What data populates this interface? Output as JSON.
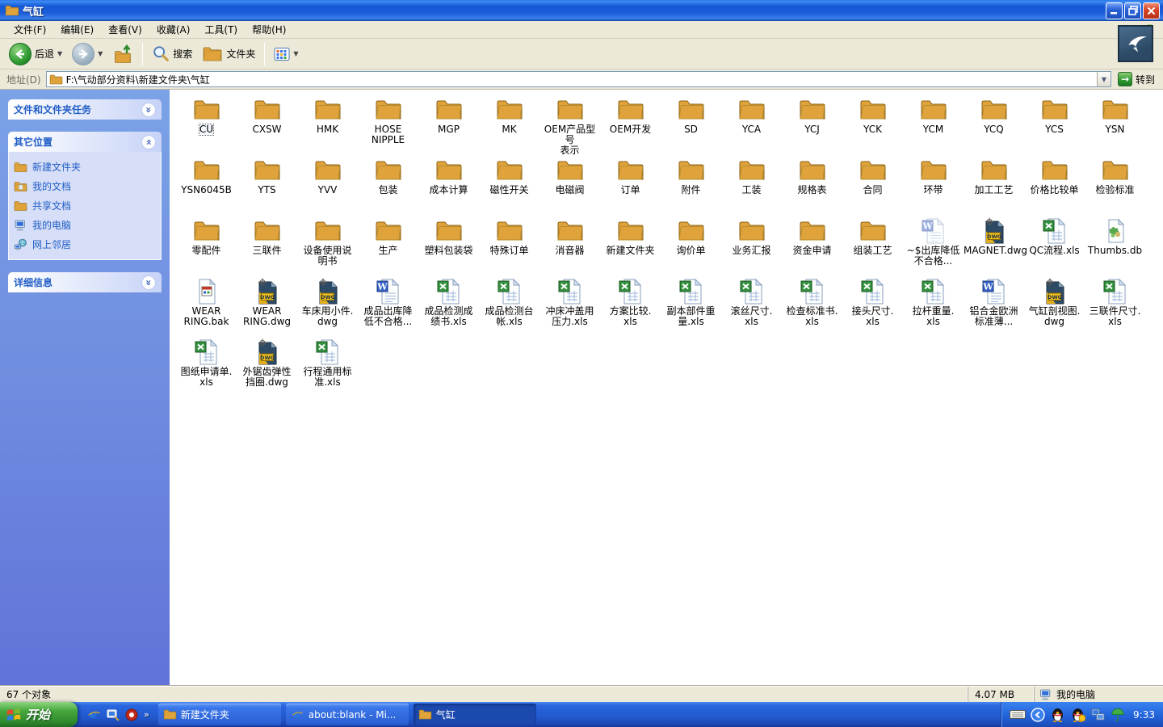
{
  "window": {
    "title": "气缸"
  },
  "menu": {
    "items": [
      "文件(F)",
      "编辑(E)",
      "查看(V)",
      "收藏(A)",
      "工具(T)",
      "帮助(H)"
    ]
  },
  "toolbar": {
    "back_label": "后退",
    "search_label": "搜索",
    "folders_label": "文件夹"
  },
  "address": {
    "label": "地址(D)",
    "value": "F:\\气动部分资料\\新建文件夹\\气缸",
    "go_label": "转到"
  },
  "sidebar": {
    "tasks_title": "文件和文件夹任务",
    "places_title": "其它位置",
    "details_title": "详细信息",
    "places": [
      {
        "label": "新建文件夹",
        "icon": "folder"
      },
      {
        "label": "我的文档",
        "icon": "mydocs"
      },
      {
        "label": "共享文档",
        "icon": "folder"
      },
      {
        "label": "我的电脑",
        "icon": "computer"
      },
      {
        "label": "网上邻居",
        "icon": "network"
      }
    ]
  },
  "main": {
    "items": [
      {
        "l": "CU",
        "t": "folder",
        "sel": true
      },
      {
        "l": "CXSW",
        "t": "folder"
      },
      {
        "l": "HMK",
        "t": "folder"
      },
      {
        "l": "HOSE NIPPLE",
        "t": "folder"
      },
      {
        "l": "MGP",
        "t": "folder"
      },
      {
        "l": "MK",
        "t": "folder"
      },
      {
        "l": "OEM产品型号\n表示",
        "t": "folder"
      },
      {
        "l": "OEM开发",
        "t": "folder"
      },
      {
        "l": "SD",
        "t": "folder"
      },
      {
        "l": "YCA",
        "t": "folder"
      },
      {
        "l": "YCJ",
        "t": "folder"
      },
      {
        "l": "YCK",
        "t": "folder"
      },
      {
        "l": "YCM",
        "t": "folder"
      },
      {
        "l": "YCQ",
        "t": "folder"
      },
      {
        "l": "YCS",
        "t": "folder"
      },
      {
        "l": "YSN",
        "t": "folder"
      },
      {
        "l": "YSN6045B",
        "t": "folder"
      },
      {
        "l": "YTS",
        "t": "folder"
      },
      {
        "l": "YVV",
        "t": "folder"
      },
      {
        "l": "包装",
        "t": "folder"
      },
      {
        "l": "成本计算",
        "t": "folder"
      },
      {
        "l": "磁性开关",
        "t": "folder"
      },
      {
        "l": "电磁阀",
        "t": "folder"
      },
      {
        "l": "订单",
        "t": "folder"
      },
      {
        "l": "附件",
        "t": "folder"
      },
      {
        "l": "工装",
        "t": "folder"
      },
      {
        "l": "规格表",
        "t": "folder"
      },
      {
        "l": "合同",
        "t": "folder"
      },
      {
        "l": "环带",
        "t": "folder"
      },
      {
        "l": "加工工艺",
        "t": "folder"
      },
      {
        "l": "价格比较单",
        "t": "folder"
      },
      {
        "l": "检验标准",
        "t": "folder"
      },
      {
        "l": "零配件",
        "t": "folder"
      },
      {
        "l": "三联件",
        "t": "folder"
      },
      {
        "l": "设备使用说\n明书",
        "t": "folder"
      },
      {
        "l": "生产",
        "t": "folder"
      },
      {
        "l": "塑料包装袋",
        "t": "folder"
      },
      {
        "l": "特殊订单",
        "t": "folder"
      },
      {
        "l": "消音器",
        "t": "folder"
      },
      {
        "l": "新建文件夹",
        "t": "folder"
      },
      {
        "l": "询价单",
        "t": "folder"
      },
      {
        "l": "业务汇报",
        "t": "folder"
      },
      {
        "l": "资金申请",
        "t": "folder"
      },
      {
        "l": "组装工艺",
        "t": "folder"
      },
      {
        "l": "~$出库降低\n不合格...",
        "t": "doctemp"
      },
      {
        "l": "MAGNET.dwg",
        "t": "dwg"
      },
      {
        "l": "QC流程.xls",
        "t": "xls"
      },
      {
        "l": "Thumbs.db",
        "t": "db"
      },
      {
        "l": "WEAR\nRING.bak",
        "t": "bak"
      },
      {
        "l": "WEAR\nRING.dwg",
        "t": "dwg"
      },
      {
        "l": "车床用小件.\ndwg",
        "t": "dwg"
      },
      {
        "l": "成品出库降\n低不合格...",
        "t": "doc"
      },
      {
        "l": "成品检测成\n绩书.xls",
        "t": "xls"
      },
      {
        "l": "成品检测台\n帐.xls",
        "t": "xls"
      },
      {
        "l": "冲床冲盖用\n压力.xls",
        "t": "xls"
      },
      {
        "l": "方案比较.\nxls",
        "t": "xls"
      },
      {
        "l": "副本部件重\n量.xls",
        "t": "xls"
      },
      {
        "l": "滚丝尺寸.\nxls",
        "t": "xls"
      },
      {
        "l": "检查标准书.\nxls",
        "t": "xls"
      },
      {
        "l": "接头尺寸.\nxls",
        "t": "xls"
      },
      {
        "l": "拉杆重量.\nxls",
        "t": "xls"
      },
      {
        "l": "铝合金欧洲\n标准薄...",
        "t": "doc"
      },
      {
        "l": "气缸剖视图.\ndwg",
        "t": "dwg"
      },
      {
        "l": "三联件尺寸.\nxls",
        "t": "xls"
      },
      {
        "l": "图纸申请单.\nxls",
        "t": "xls"
      },
      {
        "l": "外锯齿弹性\n挡圈.dwg",
        "t": "dwg"
      },
      {
        "l": "行程通用标\n准.xls",
        "t": "xls"
      }
    ]
  },
  "statusbar": {
    "objects": "67 个对象",
    "size": "4.07 MB",
    "zone": "我的电脑"
  },
  "taskbar": {
    "start_label": "开始",
    "buttons": [
      {
        "label": "新建文件夹",
        "icon": "folder",
        "active": false
      },
      {
        "label": "about:blank - Mi...",
        "icon": "ie",
        "active": false
      },
      {
        "label": "气缸",
        "icon": "folder",
        "active": true
      }
    ],
    "time": "9:33"
  }
}
